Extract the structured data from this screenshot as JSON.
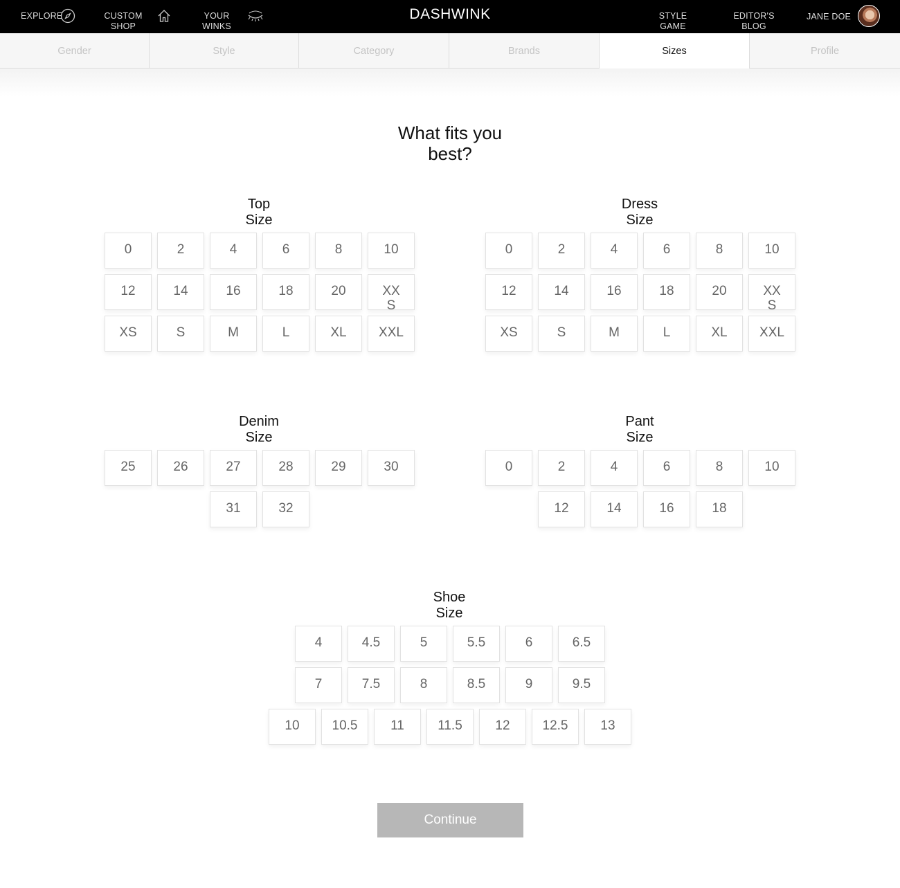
{
  "nav": {
    "explore": "EXPLORE",
    "custom_shop": "CUSTOM SHOP",
    "your_winks": "YOUR WINKS",
    "brand": "DASHWINK",
    "style_game": "STYLE GAME",
    "editors_blog": "EDITOR'S BLOG",
    "user": "JANE DOE"
  },
  "steps": [
    {
      "label": "Gender",
      "active": false
    },
    {
      "label": "Style",
      "active": false
    },
    {
      "label": "Category",
      "active": false
    },
    {
      "label": "Brands",
      "active": false
    },
    {
      "label": "Sizes",
      "active": true
    },
    {
      "label": "Profile",
      "active": false
    }
  ],
  "title": "What fits you best?",
  "groups": {
    "top": {
      "title": "Top Size",
      "rows": [
        [
          "0",
          "2",
          "4",
          "6",
          "8",
          "10"
        ],
        [
          "12",
          "14",
          "16",
          "18",
          "20",
          "XXS"
        ],
        [
          "XS",
          "S",
          "M",
          "L",
          "XL",
          "XXL"
        ]
      ]
    },
    "dress": {
      "title": "Dress Size",
      "rows": [
        [
          "0",
          "2",
          "4",
          "6",
          "8",
          "10"
        ],
        [
          "12",
          "14",
          "16",
          "18",
          "20",
          "XXS"
        ],
        [
          "XS",
          "S",
          "M",
          "L",
          "XL",
          "XXL"
        ]
      ]
    },
    "denim": {
      "title": "Denim Size",
      "rows": [
        [
          "25",
          "26",
          "27",
          "28",
          "29",
          "30"
        ],
        [
          "31",
          "32"
        ]
      ]
    },
    "pant": {
      "title": "Pant Size",
      "rows": [
        [
          "0",
          "2",
          "4",
          "6",
          "8",
          "10"
        ],
        [
          "12",
          "14",
          "16",
          "18"
        ]
      ]
    },
    "shoe": {
      "title": "Shoe Size",
      "rows": [
        [
          "4",
          "4.5",
          "5",
          "5.5",
          "6",
          "6.5"
        ],
        [
          "7",
          "7.5",
          "8",
          "8.5",
          "9",
          "9.5"
        ],
        [
          "10",
          "10.5",
          "11",
          "11.5",
          "12",
          "12.5",
          "13"
        ]
      ]
    }
  },
  "continue_label": "Continue"
}
